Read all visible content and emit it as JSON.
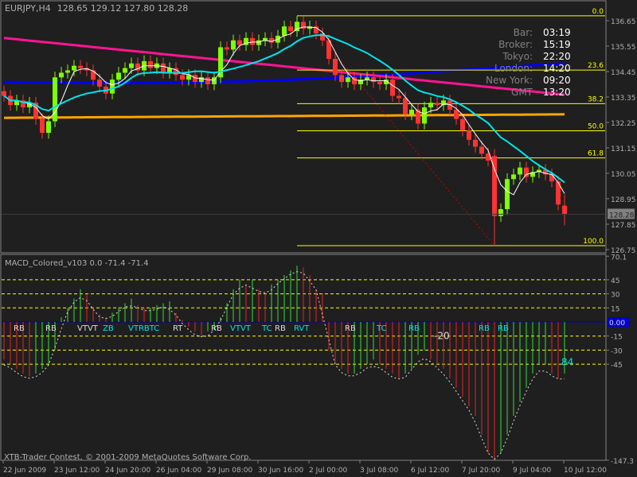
{
  "header": {
    "symbol": "EURJPY,H4",
    "ohlc": "128.65 129.12 127.80 128.28"
  },
  "info_panel": [
    {
      "label": "Bar:",
      "value": "03:19"
    },
    {
      "label": "Broker:",
      "value": "15:19"
    },
    {
      "label": "Tokyo:",
      "value": "22:20"
    },
    {
      "label": "London:",
      "value": "14:20"
    },
    {
      "label": "New York:",
      "value": "09:20"
    },
    {
      "label": "GMT",
      "value": "13:20"
    }
  ],
  "macd_title": "MACD_Colored_v103 0.0 -71.4 -71.4",
  "copyright": "XTB-Trader Contest, © 2001-2009 MetaQuotes Software Corp.",
  "current_price": "128.28",
  "macd_current": "0.00",
  "colors": {
    "bg": "#1f1f1f",
    "bull": "#7fff00",
    "bear": "#ff3333",
    "fib": "#ffff00",
    "cyan": "#00e5ee",
    "pink": "#ff1493",
    "blue": "#0000ff",
    "orange": "#ffa500"
  },
  "chart_data": [
    {
      "type": "candlestick",
      "title": "EURJPY,H4",
      "ylim": [
        126.6,
        137.3
      ],
      "price_ticks": [
        "136.65",
        "135.55",
        "134.45",
        "133.35",
        "132.25",
        "131.15",
        "130.05",
        "128.95",
        "127.85",
        "126.75"
      ],
      "time_labels": [
        {
          "bar": 0,
          "label": "22 Jun 2009"
        },
        {
          "bar": 8,
          "label": "23 Jun 12:00"
        },
        {
          "bar": 16,
          "label": "24 Jun 20:00"
        },
        {
          "bar": 24,
          "label": "26 Jun 04:00"
        },
        {
          "bar": 32,
          "label": "29 Jun 08:00"
        },
        {
          "bar": 40,
          "label": "30 Jun 16:00"
        },
        {
          "bar": 48,
          "label": "2 Jul 00:00"
        },
        {
          "bar": 56,
          "label": "3 Jul 08:00"
        },
        {
          "bar": 64,
          "label": "6 Jul 12:00"
        },
        {
          "bar": 72,
          "label": "7 Jul 20:00"
        },
        {
          "bar": 80,
          "label": "9 Jul 04:00"
        },
        {
          "bar": 88,
          "label": "10 Jul 12:00"
        }
      ],
      "close": [
        133.4,
        133.0,
        133.2,
        132.9,
        133.1,
        132.4,
        131.8,
        132.3,
        134.2,
        134.4,
        134.5,
        134.7,
        134.6,
        134.5,
        134.1,
        133.8,
        133.5,
        134.1,
        134.4,
        134.6,
        134.8,
        134.5,
        134.9,
        134.6,
        134.8,
        134.4,
        134.6,
        134.3,
        134.1,
        134.3,
        134.0,
        134.2,
        133.9,
        134.2,
        135.5,
        135.4,
        135.8,
        135.6,
        135.9,
        135.6,
        135.8,
        135.9,
        135.7,
        136.0,
        136.4,
        136.2,
        136.6,
        136.3,
        136.4,
        136.1,
        135.8,
        135.0,
        134.3,
        134.0,
        134.2,
        133.9,
        134.1,
        134.2,
        134.0,
        133.9,
        134.1,
        133.4,
        133.3,
        132.6,
        132.8,
        132.2,
        132.9,
        133.1,
        133.0,
        133.2,
        132.8,
        132.4,
        131.9,
        131.5,
        131.2,
        130.9,
        130.6,
        128.2,
        128.5,
        129.8,
        130.0,
        130.3,
        129.9,
        130.1,
        130.2,
        130.0,
        129.7,
        128.7,
        128.28
      ],
      "last_bar": {
        "open": 128.65,
        "high": 129.12,
        "low": 127.8,
        "close": 128.28
      },
      "swing_low": 126.92,
      "moving_averages": [
        {
          "name": "fast",
          "color": "#ffffff",
          "period": 4
        },
        {
          "name": "medium",
          "color": "#00e5ee",
          "period": 14
        },
        {
          "name": "slow-blue",
          "color": "#0000ff",
          "from": 134.0,
          "to": 134.65
        },
        {
          "name": "slow-pink",
          "color": "#ff1493",
          "from": 135.9,
          "to": 133.45
        },
        {
          "name": "slow-orange",
          "color": "#ffa500",
          "from": 132.45,
          "to": 132.6
        }
      ],
      "fibonacci": {
        "high": 136.86,
        "low": 126.92,
        "start_bar": 46,
        "levels": [
          "0.0",
          "23.6",
          "38.2",
          "50.0",
          "61.8",
          "100.0"
        ]
      },
      "trendline": {
        "from": {
          "bar": 49,
          "price": 136.2
        },
        "to": {
          "bar": 77,
          "price": 126.92
        }
      }
    },
    {
      "type": "bar",
      "title": "MACD_Colored_v103 0.0 -71.4 -71.4",
      "ylim": [
        -147.3,
        70.1
      ],
      "y_ticks": [
        "70.1",
        "45",
        "30",
        "15",
        "-15",
        "-30",
        "-45",
        "-147.3"
      ],
      "levels": [
        45,
        30,
        15,
        -15,
        -30,
        -45
      ],
      "histogram": [
        -40,
        -45,
        -50,
        -55,
        -58,
        -55,
        -50,
        -45,
        -30,
        5,
        15,
        25,
        35,
        30,
        15,
        8,
        5,
        10,
        15,
        20,
        25,
        18,
        15,
        15,
        18,
        20,
        22,
        10,
        2,
        -5,
        -10,
        -15,
        -10,
        -8,
        5,
        20,
        35,
        45,
        40,
        45,
        35,
        30,
        40,
        45,
        50,
        55,
        60,
        58,
        50,
        35,
        30,
        -30,
        -45,
        -50,
        -55,
        -55,
        -50,
        -45,
        -40,
        -45,
        -50,
        -55,
        -60,
        -55,
        -50,
        -35,
        -30,
        -40,
        -45,
        -50,
        -60,
        -70,
        -80,
        -90,
        -100,
        -120,
        -140,
        -147,
        -140,
        -120,
        -100,
        -85,
        -70,
        -55,
        -45,
        -45,
        -55,
        -60,
        -55
      ],
      "signals": [
        {
          "bar": 1,
          "text": "RB",
          "color": "#dddddd"
        },
        {
          "bar": 6,
          "text": "RB",
          "color": "#dddddd"
        },
        {
          "bar": 11,
          "text": "VTVT",
          "color": "#dddddd"
        },
        {
          "bar": 15,
          "text": "ZB",
          "color": "#00e5ee"
        },
        {
          "bar": 19,
          "text": "VTRBTC",
          "color": "#00e5ee"
        },
        {
          "bar": 26,
          "text": "RT",
          "color": "#dddddd"
        },
        {
          "bar": 32,
          "text": "RB",
          "color": "#dddddd"
        },
        {
          "bar": 35,
          "text": "VTVT",
          "color": "#00e5ee"
        },
        {
          "bar": 40,
          "text": "TC",
          "color": "#00e5ee"
        },
        {
          "bar": 42,
          "text": "RB",
          "color": "#dddddd"
        },
        {
          "bar": 45,
          "text": "RVT",
          "color": "#00e5ee"
        },
        {
          "bar": 53,
          "text": "RB",
          "color": "#dddddd"
        },
        {
          "bar": 58,
          "text": "TC",
          "color": "#00e5ee"
        },
        {
          "bar": 63,
          "text": "RB",
          "color": "#00e5ee"
        },
        {
          "bar": 74,
          "text": "RB",
          "color": "#00e5ee"
        },
        {
          "bar": 77,
          "text": "RB",
          "color": "#00e5ee"
        }
      ],
      "annotations": [
        {
          "bar": 68,
          "value": -15,
          "text": "-20",
          "color": "#dddddd"
        },
        {
          "bar": 88,
          "value": -43,
          "text": "84",
          "color": "#00e5ee"
        }
      ]
    }
  ]
}
